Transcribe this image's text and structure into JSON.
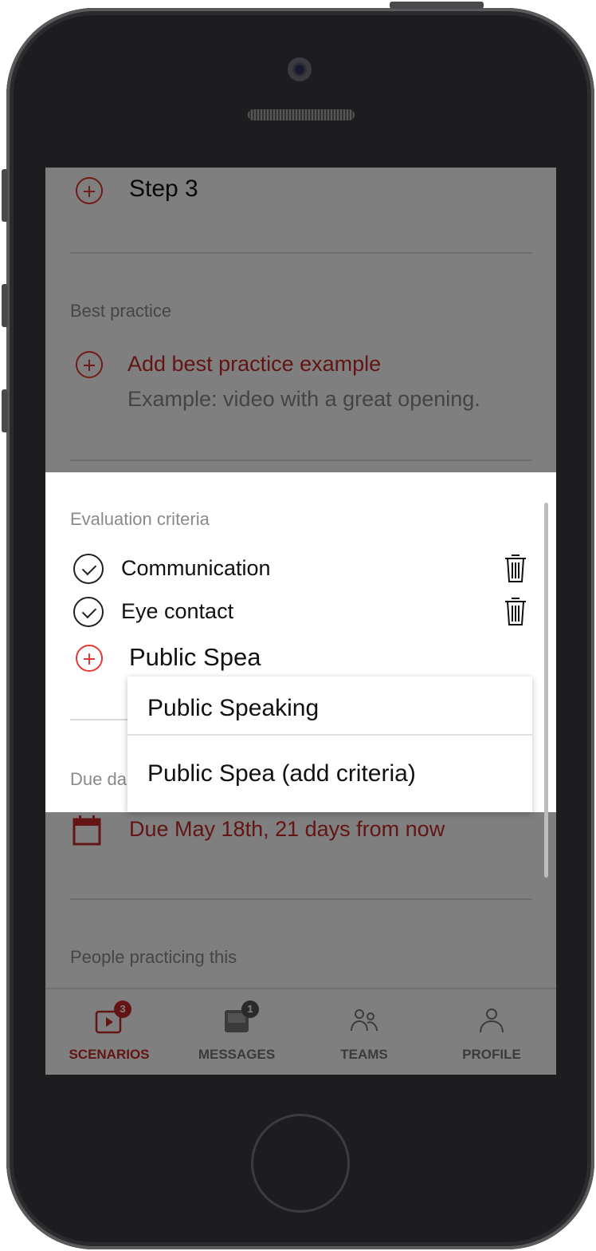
{
  "steps": {
    "step3_label": "Step 3"
  },
  "best_practice": {
    "label": "Best practice",
    "add_label": "Add best practice example",
    "hint": "Example: video with a great opening."
  },
  "evaluation": {
    "label": "Evaluation criteria",
    "criteria": [
      "Communication",
      "Eye contact"
    ],
    "input_value": "Public Spea"
  },
  "dropdown": {
    "options": [
      "Public Speaking",
      "Public Spea (add criteria)"
    ]
  },
  "due_date": {
    "label": "Due da",
    "text": "Due May 18th, 21 days from now"
  },
  "people": {
    "label": "People practicing this"
  },
  "tabs": [
    {
      "label": "SCENARIOS",
      "badge": "3",
      "icon": "scenarios-icon",
      "active": true
    },
    {
      "label": "MESSAGES",
      "badge": "1",
      "icon": "inbox-icon",
      "active": false
    },
    {
      "label": "TEAMS",
      "icon": "teams-icon",
      "active": false
    },
    {
      "label": "PROFILE",
      "icon": "profile-icon",
      "active": false
    }
  ],
  "colors": {
    "accent": "#c62828",
    "badge_scenarios": "#c62828",
    "badge_messages": "#555555"
  }
}
